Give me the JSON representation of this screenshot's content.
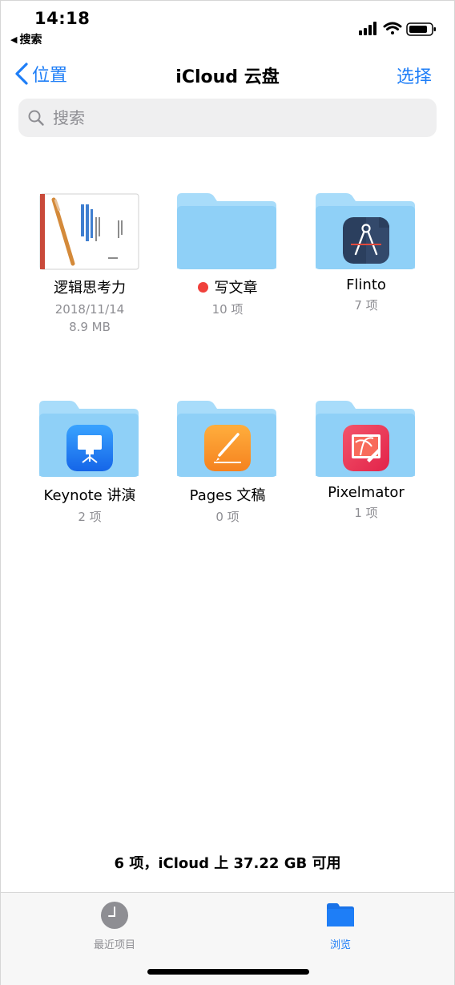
{
  "status_bar": {
    "time": "14:18",
    "back_app_label": "搜索",
    "icons": [
      "cellular-signal-icon",
      "wifi-icon",
      "battery-icon"
    ]
  },
  "nav": {
    "back_label": "位置",
    "title": "iCloud 云盘",
    "action_label": "选择"
  },
  "search": {
    "placeholder": "搜索"
  },
  "items": [
    {
      "name": "逻辑思考力",
      "meta1": "2018/11/14",
      "meta2": "8.9 MB",
      "kind": "document"
    },
    {
      "name": "写文章",
      "meta1": "10 项",
      "kind": "folder",
      "tag_color": "#f0403b"
    },
    {
      "name": "Flinto",
      "meta1": "7 项",
      "kind": "app-folder",
      "app_icon": "flinto-icon"
    },
    {
      "name": "Keynote 讲演",
      "meta1": "2 项",
      "kind": "app-folder",
      "app_icon": "keynote-icon"
    },
    {
      "name": "Pages 文稿",
      "meta1": "0 项",
      "kind": "app-folder",
      "app_icon": "pages-icon"
    },
    {
      "name": "Pixelmator",
      "meta1": "1 项",
      "kind": "app-folder",
      "app_icon": "pixelmator-icon"
    }
  ],
  "footer": {
    "summary": "6 项，iCloud 上 37.22 GB 可用"
  },
  "tabbar": {
    "tabs": [
      {
        "label": "最近项目",
        "icon": "clock-icon",
        "active": false
      },
      {
        "label": "浏览",
        "icon": "folder-icon",
        "active": true
      }
    ]
  },
  "colors": {
    "accent": "#1e7ef7",
    "folder": "#8fd0f7",
    "folder_tab": "#a8dcfa",
    "inactive": "#8e8e93"
  }
}
